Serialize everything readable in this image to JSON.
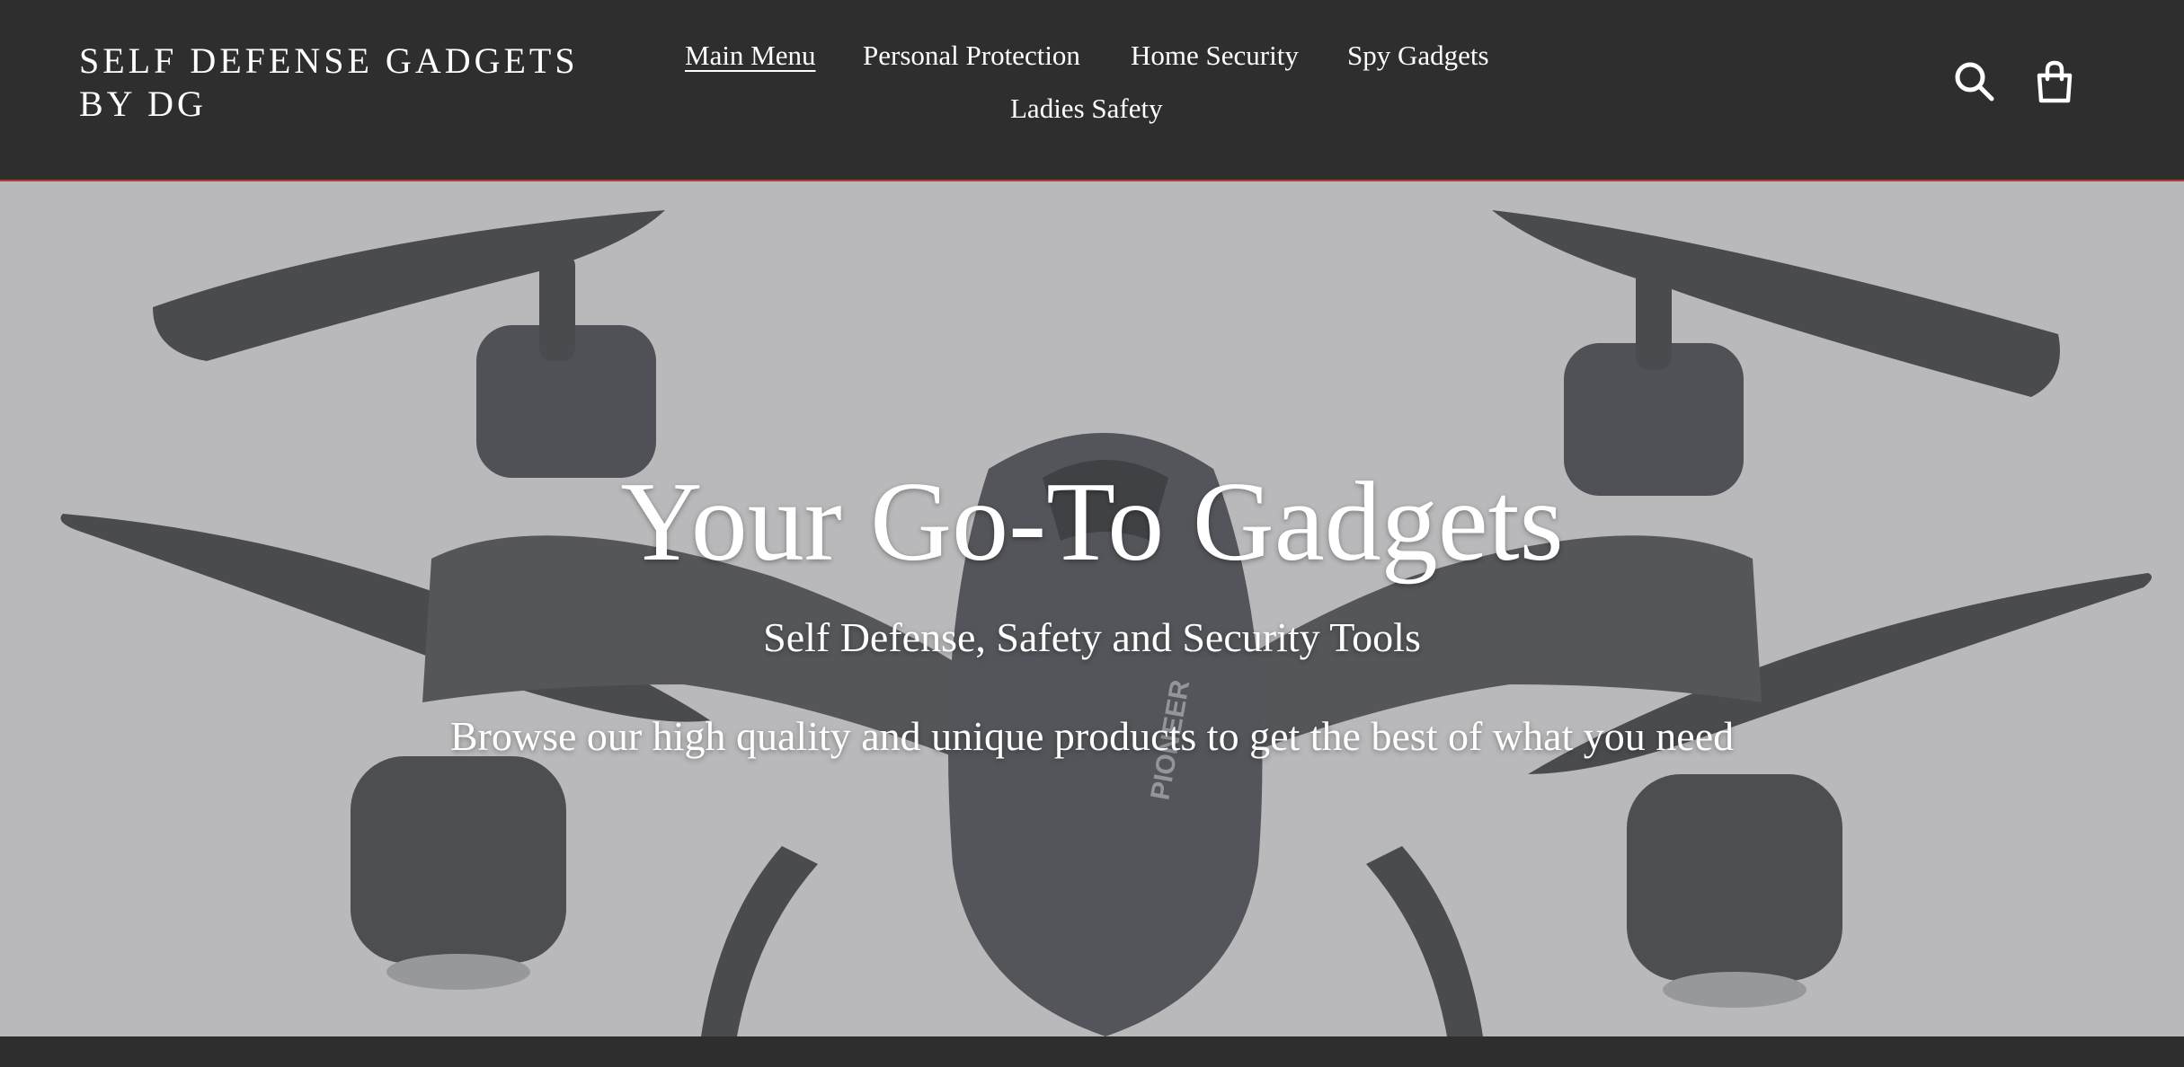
{
  "header": {
    "logo_line1": "SELF DEFENSE GADGETS",
    "logo_line2": "BY DG",
    "nav": [
      {
        "label": "Main Menu",
        "active": true
      },
      {
        "label": "Personal Protection",
        "active": false
      },
      {
        "label": "Home Security",
        "active": false
      },
      {
        "label": "Spy Gadgets",
        "active": false
      },
      {
        "label": "Ladies Safety",
        "active": false
      }
    ],
    "search_icon": "search-icon",
    "cart_icon": "cart-icon"
  },
  "hero": {
    "title": "Your Go-To Gadgets",
    "subtitle": "Self Defense, Safety and Security Tools",
    "description": "Browse our high quality and unique products to get the best of what you need",
    "image": "drone-image",
    "drone_label": "PIONEER"
  },
  "colors": {
    "header_bg": "#2e2e2e",
    "header_border": "#b33a3a",
    "hero_bg": "#b3b4b6",
    "text": "#ffffff"
  }
}
